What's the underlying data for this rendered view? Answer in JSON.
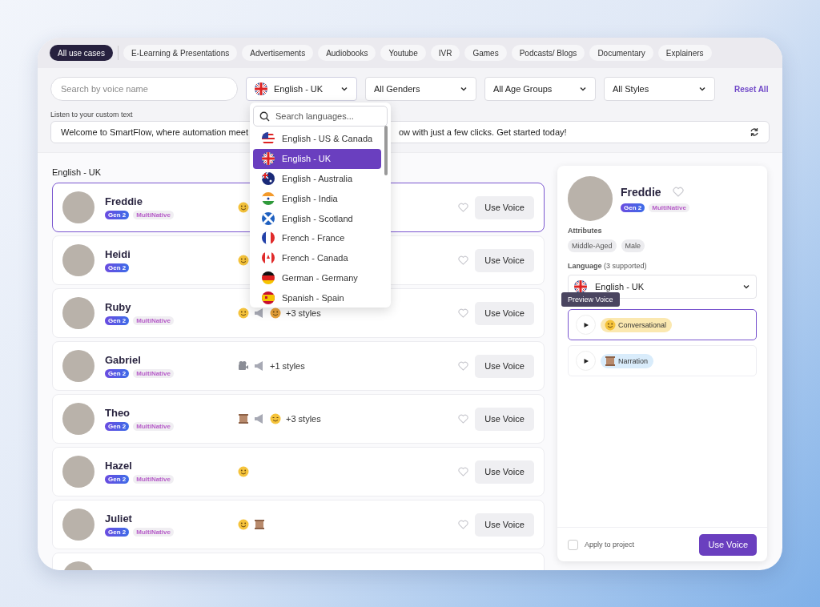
{
  "use_case_tabs": [
    {
      "label": "All use cases",
      "selected": true
    },
    {
      "label": "E-Learning & Presentations",
      "selected": false
    },
    {
      "label": "Advertisements",
      "selected": false
    },
    {
      "label": "Audiobooks",
      "selected": false
    },
    {
      "label": "Youtube",
      "selected": false
    },
    {
      "label": "IVR",
      "selected": false
    },
    {
      "label": "Games",
      "selected": false
    },
    {
      "label": "Podcasts/ Blogs",
      "selected": false
    },
    {
      "label": "Documentary",
      "selected": false
    },
    {
      "label": "Explainers",
      "selected": false
    }
  ],
  "filters": {
    "search": {
      "placeholder": "Search by voice name"
    },
    "language": {
      "value": "English - UK",
      "kind": "uk",
      "expanded": true
    },
    "selects": [
      "All Genders",
      "All Age Groups",
      "All Styles"
    ],
    "reset": "Reset All"
  },
  "language_menu": {
    "search_placeholder": "Search languages...",
    "options": [
      {
        "label": "English - US & Canada",
        "kind": "us",
        "selected": false
      },
      {
        "label": "English - UK",
        "kind": "uk",
        "selected": true
      },
      {
        "label": "English - Australia",
        "kind": "au",
        "selected": false
      },
      {
        "label": "English - India",
        "kind": "in",
        "selected": false
      },
      {
        "label": "English - Scotland",
        "kind": "scot",
        "selected": false
      },
      {
        "label": "French - France",
        "kind": "fr",
        "selected": false
      },
      {
        "label": "French - Canada",
        "kind": "ca",
        "selected": false
      },
      {
        "label": "German - Germany",
        "kind": "de",
        "selected": false
      },
      {
        "label": "Spanish - Spain",
        "kind": "es",
        "selected": false
      }
    ]
  },
  "custom_text": {
    "label": "Listen to your custom text",
    "visible_start": "Welcome to SmartFlow, where automation meet",
    "visible_end": "ow with just a few clicks. Get started today!"
  },
  "list_heading": "English - UK",
  "voices": [
    {
      "name": "Freddie",
      "gen": "Gen 2",
      "multinative": "MultiNative",
      "styles": [
        {
          "kind": "happy"
        }
      ],
      "selected": true,
      "button": "Use Voice"
    },
    {
      "name": "Heidi",
      "gen": "Gen 2",
      "styles": [
        {
          "kind": "happy"
        }
      ],
      "selected": false,
      "button": "Use Voice"
    },
    {
      "name": "Ruby",
      "gen": "Gen 2",
      "multinative": "MultiNative",
      "styles": [
        {
          "kind": "happy"
        },
        {
          "kind": "promo"
        },
        {
          "kind": "angry"
        }
      ],
      "more": "+3 styles",
      "selected": false,
      "button": "Use Voice"
    },
    {
      "name": "Gabriel",
      "gen": "Gen 2",
      "multinative": "MultiNative",
      "styles": [
        {
          "kind": "camera"
        },
        {
          "kind": "promo"
        }
      ],
      "more": "+1 styles",
      "selected": false,
      "button": "Use Voice"
    },
    {
      "name": "Theo",
      "gen": "Gen 2",
      "multinative": "MultiNative",
      "styles": [
        {
          "kind": "narration"
        },
        {
          "kind": "promo"
        },
        {
          "kind": "calm"
        }
      ],
      "more": "+3 styles",
      "selected": false,
      "button": "Use Voice"
    },
    {
      "name": "Hazel",
      "gen": "Gen 2",
      "multinative": "MultiNative",
      "styles": [
        {
          "kind": "happy"
        }
      ],
      "selected": false,
      "button": "Use Voice"
    },
    {
      "name": "Juliet",
      "gen": "Gen 2",
      "multinative": "MultiNative",
      "styles": [
        {
          "kind": "happy"
        },
        {
          "kind": "narration"
        }
      ],
      "selected": false,
      "button": "Use Voice"
    }
  ],
  "detail": {
    "name": "Freddie",
    "gen": "Gen 2",
    "multinative": "MultiNative",
    "attributes_label": "Attributes",
    "attributes": [
      "Middle-Aged",
      "Male"
    ],
    "language_label": "**Language** (3 supported)",
    "language": {
      "value": "English - UK",
      "kind": "uk"
    },
    "tooltip": "Preview Voice",
    "styles": [
      {
        "label": "Conversational",
        "kind": "happy",
        "selected": true
      },
      {
        "label": "Narration",
        "kind": "narration",
        "selected": false
      }
    ],
    "apply": {
      "label": "Apply to project",
      "checked": false
    },
    "button": "Use Voice"
  }
}
